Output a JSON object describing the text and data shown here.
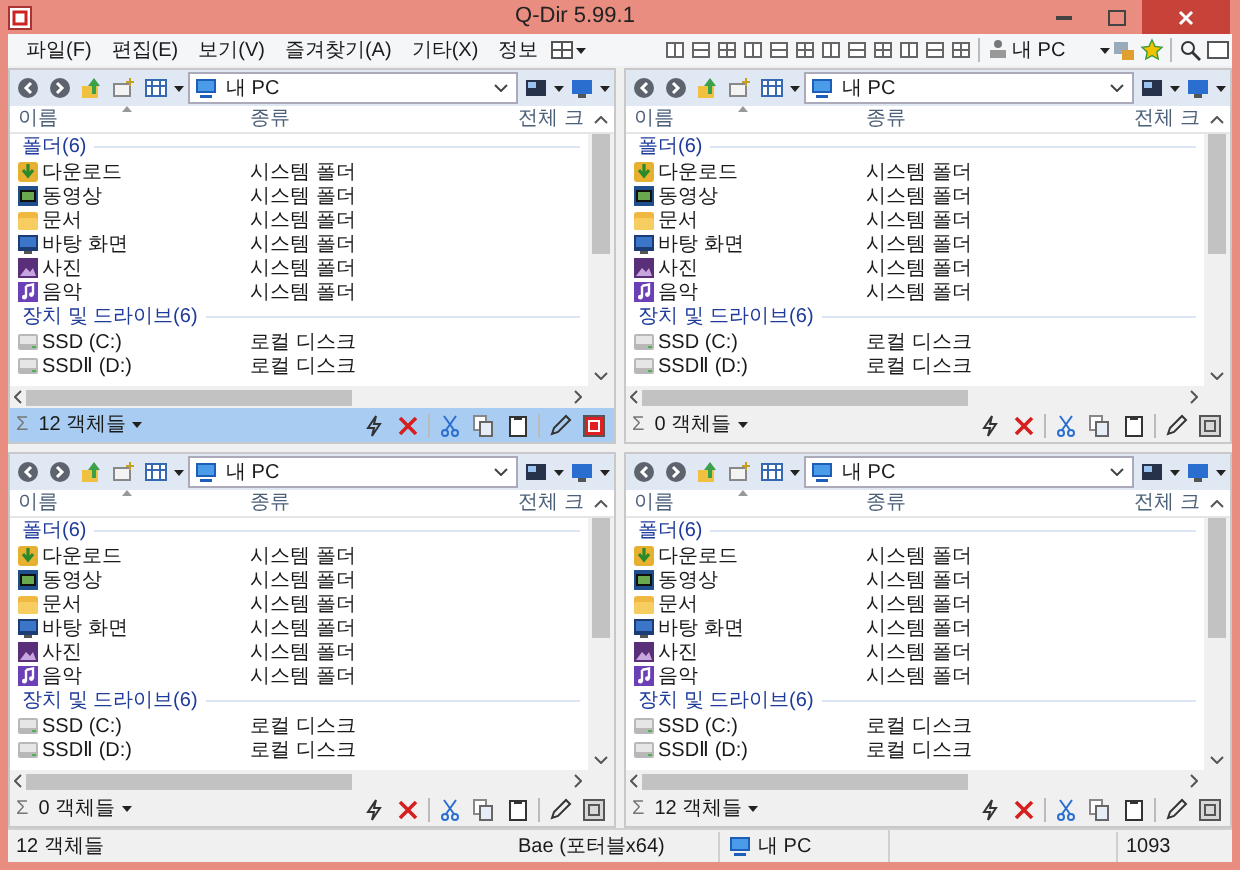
{
  "window": {
    "title": "Q-Dir 5.99.1"
  },
  "menu": [
    {
      "label": "파일(F)"
    },
    {
      "label": "편집(E)"
    },
    {
      "label": "보기(V)"
    },
    {
      "label": "즐겨찾기(A)"
    },
    {
      "label": "기타(X)"
    },
    {
      "label": "정보"
    }
  ],
  "toolbar": {
    "location": "내 PC"
  },
  "panes": [
    {
      "selected": true,
      "address": "내 PC",
      "columns": [
        "이름",
        "종류",
        "전체 크"
      ],
      "sum_symbol": "Σ",
      "status": "12 객체들",
      "groups": [
        {
          "label": "폴더(6)",
          "items": [
            {
              "name": "다운로드",
              "type": "시스템 폴더",
              "kind": "download"
            },
            {
              "name": "동영상",
              "type": "시스템 폴더",
              "kind": "video"
            },
            {
              "name": "문서",
              "type": "시스템 폴더",
              "kind": "document"
            },
            {
              "name": "바탕 화면",
              "type": "시스템 폴더",
              "kind": "desktop"
            },
            {
              "name": "사진",
              "type": "시스템 폴더",
              "kind": "picture"
            },
            {
              "name": "음악",
              "type": "시스템 폴더",
              "kind": "music"
            }
          ]
        },
        {
          "label": "장치 및 드라이브(6)",
          "items": [
            {
              "name": "SSD (C:)",
              "type": "로컬 디스크",
              "kind": "drive"
            },
            {
              "name": "SSDⅡ (D:)",
              "type": "로컬 디스크",
              "kind": "drive"
            }
          ]
        }
      ]
    },
    {
      "selected": false,
      "address": "내 PC",
      "columns": [
        "이름",
        "종류",
        "전체 크"
      ],
      "sum_symbol": "Σ",
      "status": "0 객체들",
      "groups": [
        {
          "label": "폴더(6)",
          "items": [
            {
              "name": "다운로드",
              "type": "시스템 폴더",
              "kind": "download"
            },
            {
              "name": "동영상",
              "type": "시스템 폴더",
              "kind": "video"
            },
            {
              "name": "문서",
              "type": "시스템 폴더",
              "kind": "document"
            },
            {
              "name": "바탕 화면",
              "type": "시스템 폴더",
              "kind": "desktop"
            },
            {
              "name": "사진",
              "type": "시스템 폴더",
              "kind": "picture"
            },
            {
              "name": "음악",
              "type": "시스템 폴더",
              "kind": "music"
            }
          ]
        },
        {
          "label": "장치 및 드라이브(6)",
          "items": [
            {
              "name": "SSD (C:)",
              "type": "로컬 디스크",
              "kind": "drive"
            },
            {
              "name": "SSDⅡ (D:)",
              "type": "로컬 디스크",
              "kind": "drive"
            }
          ]
        }
      ]
    },
    {
      "selected": false,
      "address": "내 PC",
      "columns": [
        "이름",
        "종류",
        "전체 크"
      ],
      "sum_symbol": "Σ",
      "status": "0 객체들",
      "groups": [
        {
          "label": "폴더(6)",
          "items": [
            {
              "name": "다운로드",
              "type": "시스템 폴더",
              "kind": "download"
            },
            {
              "name": "동영상",
              "type": "시스템 폴더",
              "kind": "video"
            },
            {
              "name": "문서",
              "type": "시스템 폴더",
              "kind": "document"
            },
            {
              "name": "바탕 화면",
              "type": "시스템 폴더",
              "kind": "desktop"
            },
            {
              "name": "사진",
              "type": "시스템 폴더",
              "kind": "picture"
            },
            {
              "name": "음악",
              "type": "시스템 폴더",
              "kind": "music"
            }
          ]
        },
        {
          "label": "장치 및 드라이브(6)",
          "items": [
            {
              "name": "SSD (C:)",
              "type": "로컬 디스크",
              "kind": "drive"
            },
            {
              "name": "SSDⅡ (D:)",
              "type": "로컬 디스크",
              "kind": "drive"
            }
          ]
        }
      ]
    },
    {
      "selected": false,
      "address": "내 PC",
      "columns": [
        "이름",
        "종류",
        "전체 크"
      ],
      "sum_symbol": "Σ",
      "status": "12 객체들",
      "groups": [
        {
          "label": "폴더(6)",
          "items": [
            {
              "name": "다운로드",
              "type": "시스템 폴더",
              "kind": "download"
            },
            {
              "name": "동영상",
              "type": "시스템 폴더",
              "kind": "video"
            },
            {
              "name": "문서",
              "type": "시스템 폴더",
              "kind": "document"
            },
            {
              "name": "바탕 화면",
              "type": "시스템 폴더",
              "kind": "desktop"
            },
            {
              "name": "사진",
              "type": "시스템 폴더",
              "kind": "picture"
            },
            {
              "name": "음악",
              "type": "시스템 폴더",
              "kind": "music"
            }
          ]
        },
        {
          "label": "장치 및 드라이브(6)",
          "items": [
            {
              "name": "SSD (C:)",
              "type": "로컬 디스크",
              "kind": "drive"
            },
            {
              "name": "SSDⅡ (D:)",
              "type": "로컬 디스크",
              "kind": "drive"
            }
          ]
        }
      ]
    }
  ],
  "status_bar": {
    "objects": "12 객체들",
    "user": "Bae (포터블x64)",
    "location": "내 PC",
    "number": "1093"
  }
}
